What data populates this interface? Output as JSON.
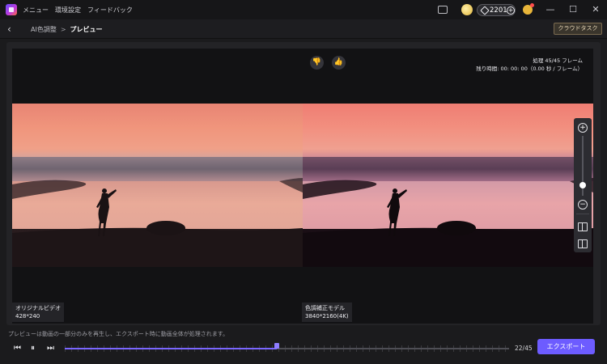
{
  "app": {
    "menu": [
      "メニュー",
      "環境設定",
      "フィードバック"
    ],
    "credits": "2201",
    "credits_plus": "+",
    "window_controls": [
      "—",
      "☐",
      "✕"
    ]
  },
  "nav": {
    "back": "‹",
    "breadcrumb_parent": "AI色調整",
    "breadcrumb_separator": ">",
    "breadcrumb_current": "プレビュー",
    "cloud_task": "クラウドタスク"
  },
  "preview": {
    "feedback": {
      "dislike": "👎",
      "like": "👍"
    },
    "frames_processed": "処理 45/45 フレーム",
    "time_remaining": "残り時間: 00: 00: 00（0.00 秒 / フレーム）",
    "original": {
      "label": "オリジナルビデオ",
      "resolution": "428*240"
    },
    "processed": {
      "label": "色調補正モデル",
      "resolution": "3840*2160(4K)"
    },
    "zoom": {
      "in": "+",
      "out": "−",
      "level": 0.17
    }
  },
  "playback": {
    "hint": "プレビューは動画の一部分のみを再生し、エクスポート時に動画全体が処理されます。",
    "prev": "⏮",
    "pause": "⏸",
    "next": "⏭",
    "progress": 0.477,
    "counter": "22/45",
    "export": "エクスポート"
  },
  "colors": {
    "accent": "#6d5cff",
    "background": "#1b1b1d"
  }
}
